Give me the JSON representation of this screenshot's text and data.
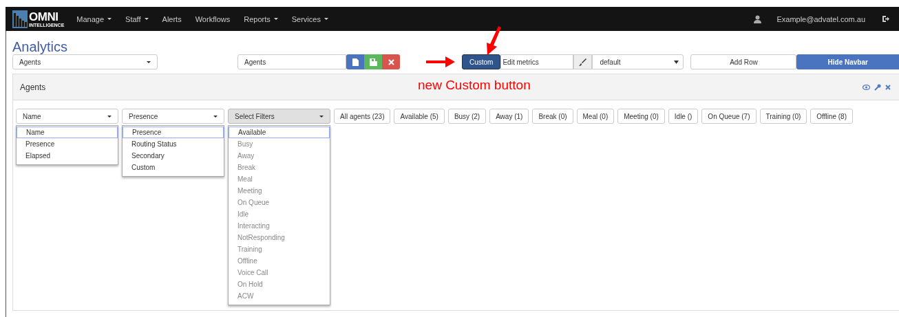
{
  "navbar": {
    "brand_top": "OMNI",
    "brand_bottom": "INTELLIGENCE",
    "menu": [
      {
        "label": "Manage",
        "dropdown": true
      },
      {
        "label": "Staff",
        "dropdown": true
      },
      {
        "label": "Alerts",
        "dropdown": false
      },
      {
        "label": "Workflows",
        "dropdown": false
      },
      {
        "label": "Reports",
        "dropdown": true
      },
      {
        "label": "Services",
        "dropdown": true
      }
    ],
    "user": "Example@advatel.com.au"
  },
  "page_title": "Analytics",
  "toolbar": {
    "view_select": "Agents",
    "name_field": "Agents",
    "custom_button": "Custom",
    "metrics_field": "Edit metrics",
    "theme_select": "default",
    "add_row": "Add Row",
    "hide_navbar": "Hide Navbar"
  },
  "annotation": {
    "text": "new Custom button"
  },
  "panel": {
    "title": "Agents",
    "selects": [
      {
        "value": "Name",
        "kind": "plain",
        "options": [
          {
            "label": "Name",
            "selected": true,
            "disabled": false
          },
          {
            "label": "Presence",
            "selected": false,
            "disabled": false
          },
          {
            "label": "Elapsed",
            "selected": false,
            "disabled": false
          }
        ]
      },
      {
        "value": "Presence",
        "kind": "plain",
        "options": [
          {
            "label": "Presence",
            "selected": true,
            "disabled": false
          },
          {
            "label": "Routing Status",
            "selected": false,
            "disabled": false
          },
          {
            "label": "Secondary",
            "selected": false,
            "disabled": false
          },
          {
            "label": "Custom",
            "selected": false,
            "disabled": false
          }
        ]
      },
      {
        "value": "Select Filters",
        "kind": "filter",
        "options": [
          {
            "label": "Available",
            "selected": true,
            "disabled": false
          },
          {
            "label": "Busy",
            "selected": false,
            "disabled": true
          },
          {
            "label": "Away",
            "selected": false,
            "disabled": true
          },
          {
            "label": "Break",
            "selected": false,
            "disabled": true
          },
          {
            "label": "Meal",
            "selected": false,
            "disabled": true
          },
          {
            "label": "Meeting",
            "selected": false,
            "disabled": true
          },
          {
            "label": "On Queue",
            "selected": false,
            "disabled": true
          },
          {
            "label": "Idle",
            "selected": false,
            "disabled": true
          },
          {
            "label": "Interacting",
            "selected": false,
            "disabled": true
          },
          {
            "label": "NotResponding",
            "selected": false,
            "disabled": true
          },
          {
            "label": "Training",
            "selected": false,
            "disabled": true
          },
          {
            "label": "Offline",
            "selected": false,
            "disabled": true
          },
          {
            "label": "Voice Call",
            "selected": false,
            "disabled": true
          },
          {
            "label": "On Hold",
            "selected": false,
            "disabled": true
          },
          {
            "label": "ACW",
            "selected": false,
            "disabled": true
          }
        ]
      }
    ],
    "filter_buttons": [
      "All agents (23)",
      "Available (5)",
      "Busy (2)",
      "Away (1)",
      "Break (0)",
      "Meal (0)",
      "Meeting (0)",
      "Idle ()",
      "On Queue (7)",
      "Training (0)",
      "Offline (8)"
    ]
  }
}
